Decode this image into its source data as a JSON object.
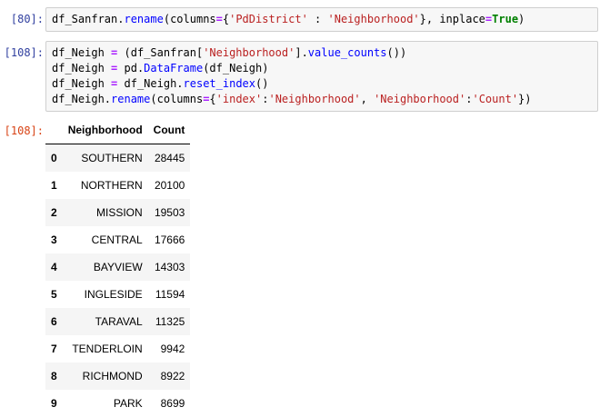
{
  "cells": [
    {
      "prompt": "[80]:",
      "lines": [
        "df_Sanfran.rename(columns={'PdDistrict' : 'Neighborhood'}, inplace=True)"
      ]
    },
    {
      "prompt": "[108]:",
      "lines": [
        "df_Neigh = (df_Sanfran['Neighborhood'].value_counts())",
        "df_Neigh = pd.DataFrame(df_Neigh)",
        "df_Neigh = df_Neigh.reset_index()",
        "df_Neigh.rename(columns={'index':'Neighborhood', 'Neighborhood':'Count'})"
      ]
    }
  ],
  "output": {
    "prompt": "[108]:",
    "columns": [
      "",
      "Neighborhood",
      "Count"
    ],
    "rows": [
      {
        "index": "0",
        "neighborhood": "SOUTHERN",
        "count": "28445"
      },
      {
        "index": "1",
        "neighborhood": "NORTHERN",
        "count": "20100"
      },
      {
        "index": "2",
        "neighborhood": "MISSION",
        "count": "19503"
      },
      {
        "index": "3",
        "neighborhood": "CENTRAL",
        "count": "17666"
      },
      {
        "index": "4",
        "neighborhood": "BAYVIEW",
        "count": "14303"
      },
      {
        "index": "5",
        "neighborhood": "INGLESIDE",
        "count": "11594"
      },
      {
        "index": "6",
        "neighborhood": "TARAVAL",
        "count": "11325"
      },
      {
        "index": "7",
        "neighborhood": "TENDERLOIN",
        "count": "9942"
      },
      {
        "index": "8",
        "neighborhood": "RICHMOND",
        "count": "8922"
      },
      {
        "index": "9",
        "neighborhood": "PARK",
        "count": "8699"
      }
    ]
  },
  "colors": {
    "input_prompt": "#303f9f",
    "output_prompt": "#d84315",
    "cell_bg": "#f7f7f7",
    "keyword": "#008000",
    "string": "#ba2121"
  }
}
